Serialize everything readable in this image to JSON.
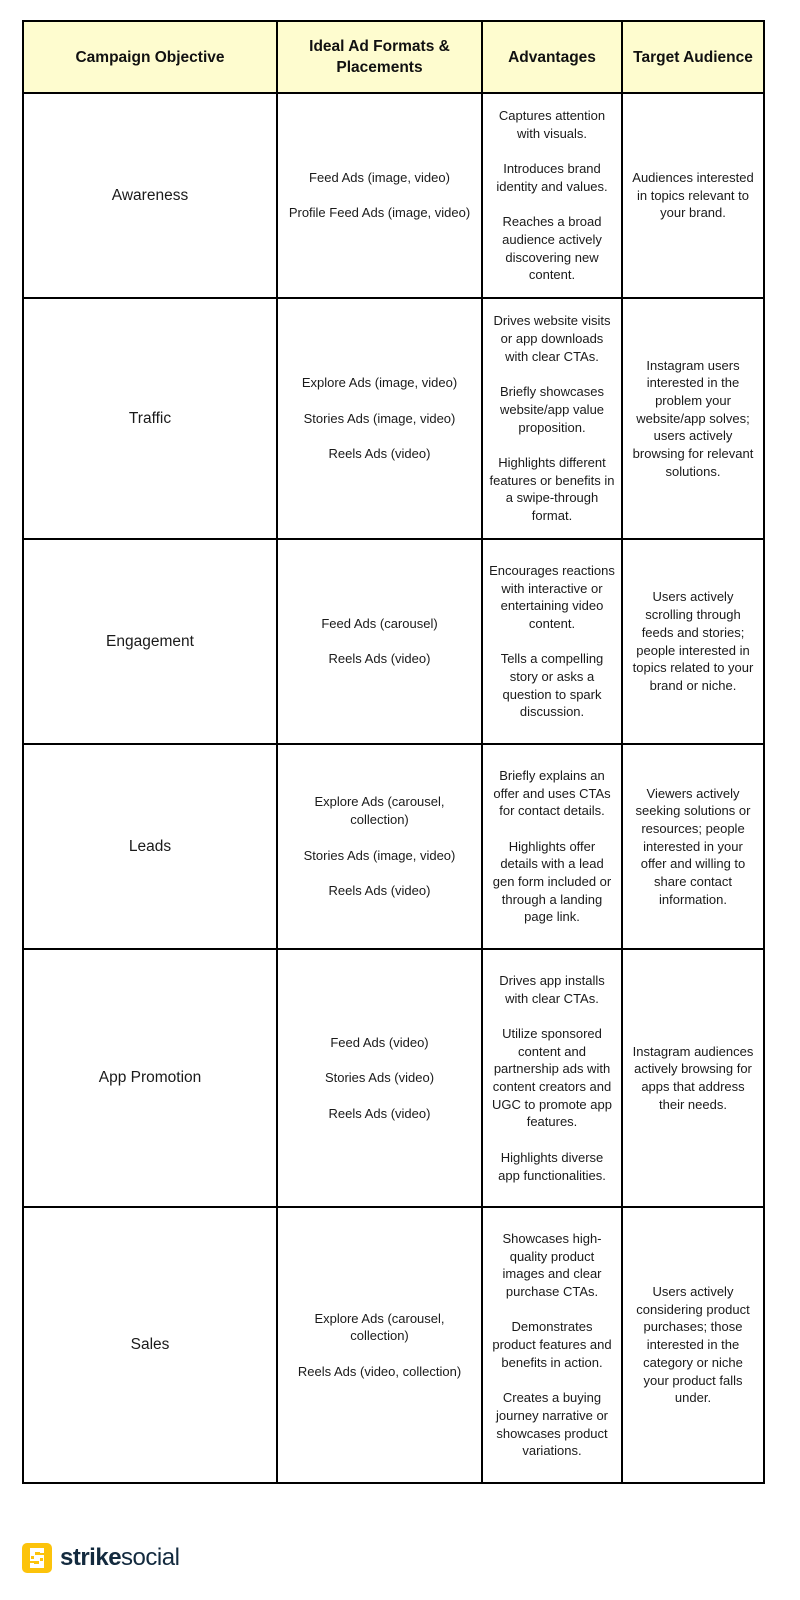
{
  "table": {
    "headers": [
      "Campaign Objective",
      "Ideal Ad Formats & Placements",
      "Advantages",
      "Target Audience"
    ],
    "rows": [
      {
        "objective": "Awareness",
        "formats": [
          "Feed Ads (image, video)",
          "Profile Feed Ads (image, video)"
        ],
        "advantages": [
          "Captures attention with visuals.",
          "Introduces brand identity and values.",
          "Reaches a broad audience actively discovering new content."
        ],
        "audience": "Audiences interested in topics relevant to your brand."
      },
      {
        "objective": "Traffic",
        "formats": [
          "Explore Ads (image, video)",
          "Stories Ads (image, video)",
          "Reels Ads (video)"
        ],
        "advantages": [
          "Drives website visits or app downloads with clear CTAs.",
          "Briefly showcases website/app value proposition.",
          "Highlights different features or benefits in a swipe-through format."
        ],
        "audience": "Instagram users interested in the problem your website/app solves; users actively browsing for relevant solutions."
      },
      {
        "objective": "Engagement",
        "formats": [
          "Feed Ads (carousel)",
          "Reels Ads (video)"
        ],
        "advantages": [
          "Encourages reactions with interactive or entertaining video content.",
          "Tells a compelling story or asks a question to spark discussion."
        ],
        "audience": "Users actively scrolling through feeds and stories; people interested in topics related to your brand or niche."
      },
      {
        "objective": "Leads",
        "formats": [
          "Explore Ads (carousel, collection)",
          "Stories Ads (image, video)",
          "Reels Ads (video)"
        ],
        "advantages": [
          "Briefly explains an offer and uses CTAs for contact details.",
          "Highlights offer details with a lead gen form included or through a landing page link."
        ],
        "audience": "Viewers actively seeking solutions or resources; people interested in your offer and willing to share contact information."
      },
      {
        "objective": "App Promotion",
        "formats": [
          "Feed Ads (video)",
          "Stories Ads (video)",
          "Reels Ads (video)"
        ],
        "advantages": [
          "Drives app installs with clear CTAs.",
          "Utilize sponsored content and partnership ads with content creators and UGC to promote app features.",
          "Highlights diverse app functionalities."
        ],
        "audience": "Instagram audiences actively browsing for apps that address their needs."
      },
      {
        "objective": "Sales",
        "formats": [
          "Explore Ads (carousel, collection)",
          "Reels Ads (video, collection)"
        ],
        "advantages": [
          "Showcases high-quality product images and clear purchase CTAs.",
          "Demonstrates product features and benefits in action.",
          "Creates a buying journey narrative or showcases product variations."
        ],
        "audience": "Users actively considering product purchases; those interested in the category or niche your product falls under."
      }
    ]
  },
  "logo": {
    "bold": "strike",
    "light": "social",
    "icon": "strike-s-icon",
    "colors": {
      "mark": "#fcc30b",
      "text": "#132a3e"
    }
  },
  "colors": {
    "header_bg": "#fefccf",
    "border": "#000000"
  }
}
